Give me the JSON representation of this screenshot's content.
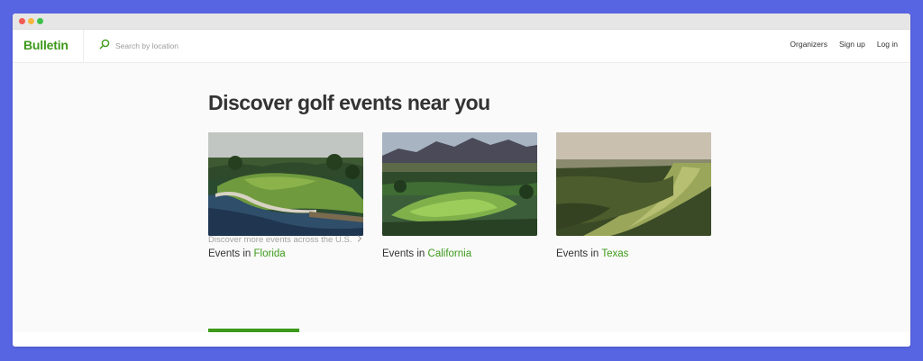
{
  "brand": {
    "name": "Bulletin",
    "accent": "#3d9a1a"
  },
  "search": {
    "placeholder": "Search by location",
    "icon": "search-icon"
  },
  "nav": {
    "organizers": "Organizers",
    "signup": "Sign up",
    "login": "Log in"
  },
  "main": {
    "headline": "Discover golf events near you",
    "cards": [
      {
        "prefix": "Events in",
        "state": "Florida"
      },
      {
        "prefix": "Events in",
        "state": "California"
      },
      {
        "prefix": "Events in",
        "state": "Texas"
      }
    ],
    "more_link": "Discover more events across the U.S.",
    "more_icon": "chevron-right-icon"
  },
  "carousel_progress": 0.18
}
